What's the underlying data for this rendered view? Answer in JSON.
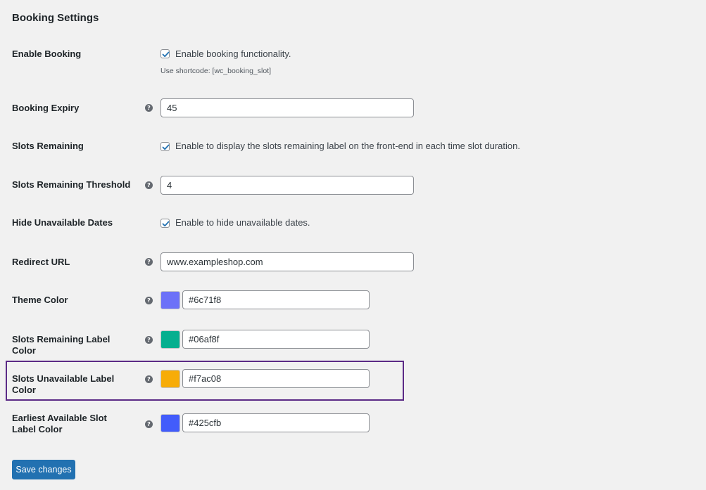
{
  "heading": "Booking Settings",
  "rows": {
    "enable_booking": {
      "label": "Enable Booking",
      "checkbox_label": "Enable booking functionality.",
      "checked": true,
      "description": "Use shortcode: [wc_booking_slot]"
    },
    "booking_expiry": {
      "label": "Booking Expiry",
      "value": "45",
      "help_icon": "question-circle-icon"
    },
    "slots_remaining": {
      "label": "Slots Remaining",
      "checkbox_label": "Enable to display the slots remaining label on the front-end in each time slot duration.",
      "checked": true
    },
    "slots_remaining_threshold": {
      "label": "Slots Remaining Threshold",
      "value": "4",
      "help_icon": "question-circle-icon"
    },
    "hide_unavailable_dates": {
      "label": "Hide Unavailable Dates",
      "checkbox_label": "Enable to hide unavailable dates.",
      "checked": true
    },
    "redirect_url": {
      "label": "Redirect URL",
      "value": "www.exampleshop.com",
      "help_icon": "question-circle-icon"
    },
    "theme_color": {
      "label": "Theme Color",
      "value": "#6c71f8",
      "swatch": "#6c71f8",
      "help_icon": "question-circle-icon"
    },
    "slots_remaining_label_color": {
      "label": "Slots Remaining Label Color",
      "value": "#06af8f",
      "swatch": "#06af8f",
      "help_icon": "question-circle-icon"
    },
    "slots_unavailable_label_color": {
      "label": "Slots Unavailable Label Color",
      "value": "#f7ac08",
      "swatch": "#f7ac08",
      "help_icon": "question-circle-icon",
      "highlighted": true
    },
    "earliest_available_slot_label_color": {
      "label": "Earliest Available Slot Label Color",
      "value": "#425cfb",
      "swatch": "#425cfb",
      "help_icon": "question-circle-icon"
    }
  },
  "save_button": "Save changes",
  "colors": {
    "highlight_border": "#5b2a86",
    "primary_button": "#2271b1",
    "background": "#f1f1f1"
  }
}
